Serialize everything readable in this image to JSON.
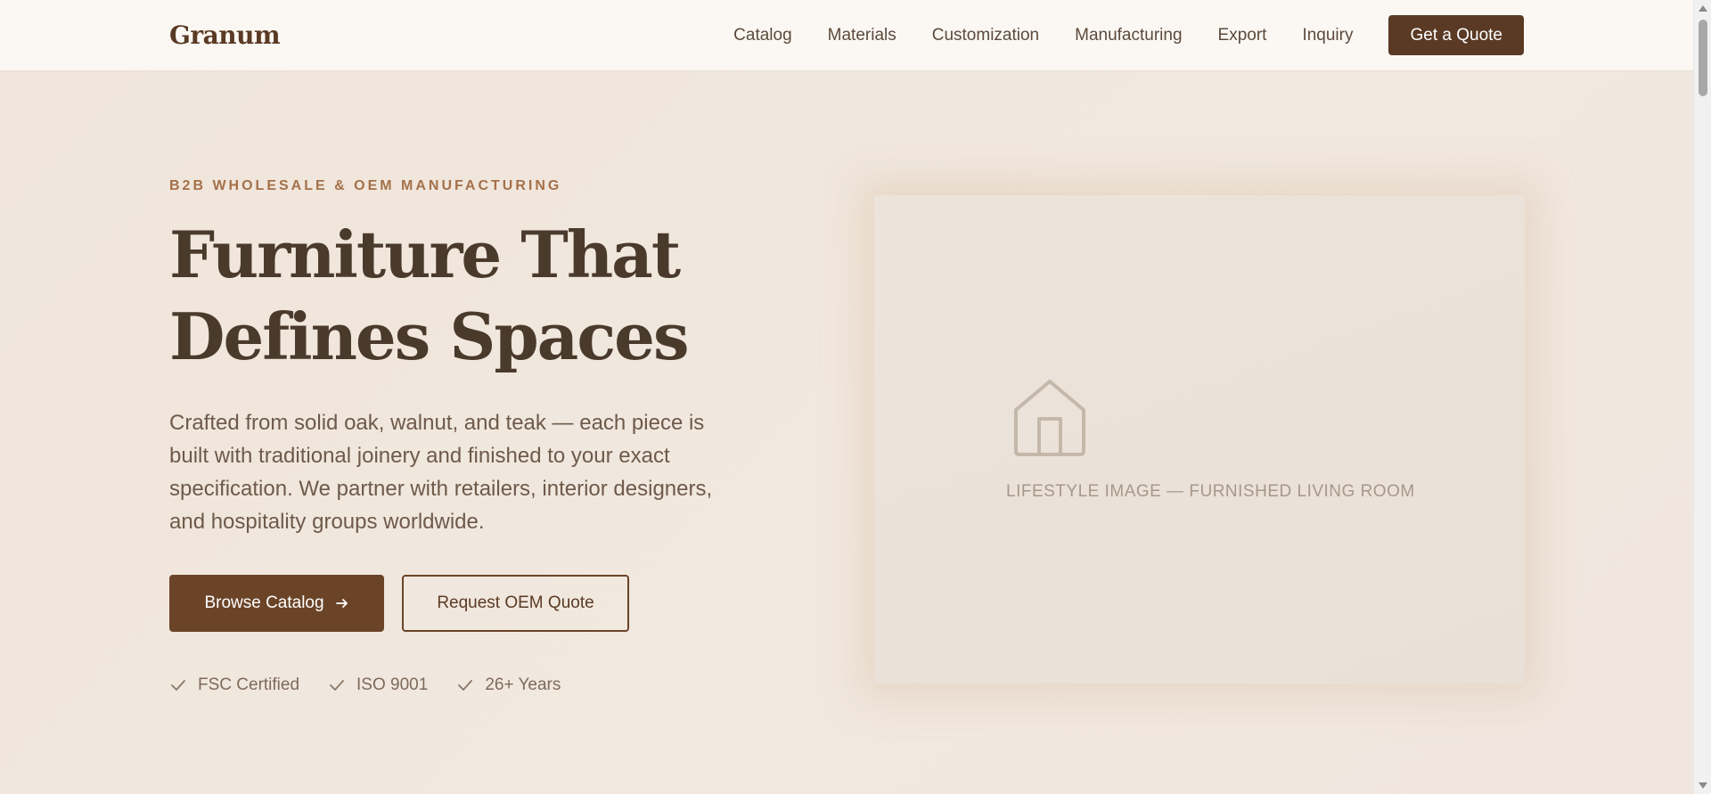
{
  "header": {
    "brand": "Granum",
    "nav": [
      "Catalog",
      "Materials",
      "Customization",
      "Manufacturing",
      "Export",
      "Inquiry"
    ],
    "cta": "Get a Quote"
  },
  "hero": {
    "eyebrow": "B2B WHOLESALE & OEM MANUFACTURING",
    "headline_line1": "Furniture That",
    "headline_line2": "Defines Spaces",
    "lead": "Crafted from solid oak, walnut, and teak — each piece is built with traditional joinery and finished to your exact specification. We partner with retailers, interior designers, and hospitality groups worldwide.",
    "primary_button": "Browse Catalog",
    "primary_icon": "arrow-right-icon",
    "secondary_button": "Request OEM Quote",
    "badges": [
      "FSC Certified",
      "ISO 9001",
      "26+ Years"
    ],
    "badge_icon": "check-icon"
  },
  "media": {
    "icon": "house-icon",
    "label": "LIFESTYLE IMAGE — FURNISHED LIVING ROOM"
  },
  "colors": {
    "brand": "#5a3a24",
    "primary_button": "#6b4428",
    "accent": "#a4714a",
    "background": "#f0e7dd"
  }
}
